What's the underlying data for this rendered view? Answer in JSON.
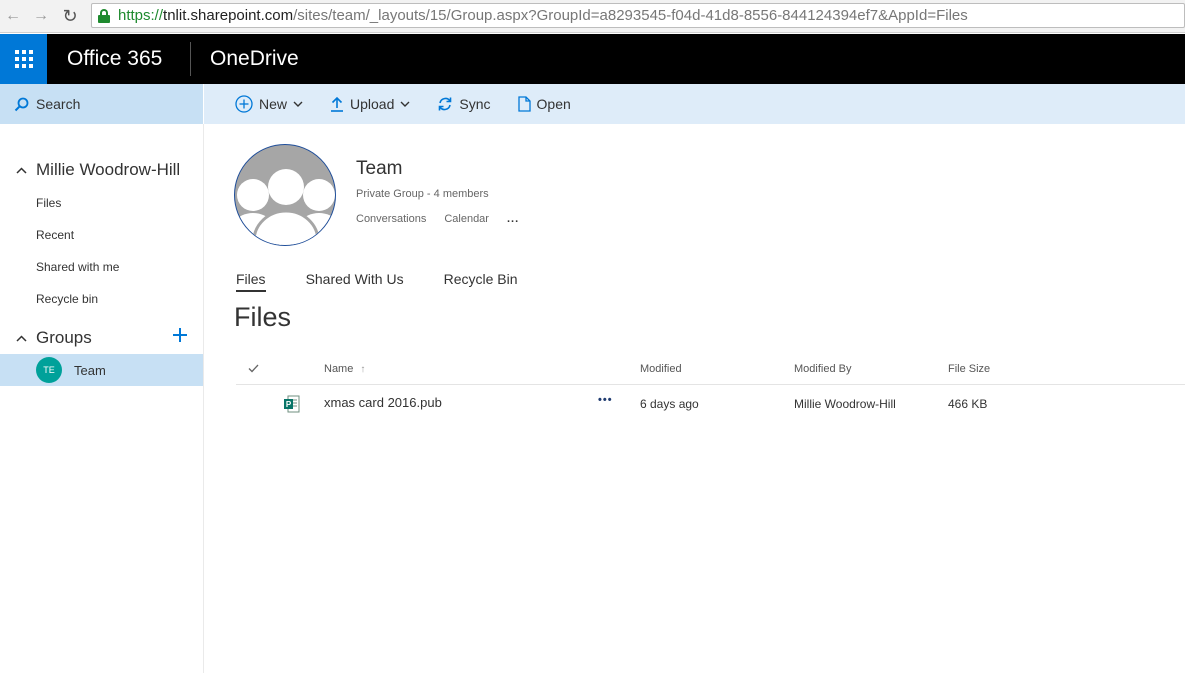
{
  "browser": {
    "url_scheme": "https://",
    "url_host": "tnlit.sharepoint.com",
    "url_path": "/sites/team/_layouts/15/Group.aspx?GroupId=a8293545-f04d-41d8-8556-844124394ef7&AppId=Files"
  },
  "suite": {
    "brand": "Office 365",
    "app": "OneDrive"
  },
  "search": {
    "label": "Search"
  },
  "commands": {
    "new": "New",
    "upload": "Upload",
    "sync": "Sync",
    "open": "Open"
  },
  "nav": {
    "user": "Millie Woodrow-Hill",
    "items": [
      "Files",
      "Recent",
      "Shared with me",
      "Recycle bin"
    ],
    "groups_label": "Groups",
    "group": {
      "initials": "TE",
      "name": "Team"
    }
  },
  "group": {
    "title": "Team",
    "subtitle": "Private Group - 4 members",
    "links": [
      "Conversations",
      "Calendar"
    ],
    "more": "..."
  },
  "pivots": [
    "Files",
    "Shared With Us",
    "Recycle Bin"
  ],
  "files_heading": "Files",
  "table": {
    "columns": {
      "name": "Name",
      "sort_indicator": "↑",
      "modified": "Modified",
      "modified_by": "Modified By",
      "size": "File Size"
    },
    "rows": [
      {
        "name": "xmas card 2016.pub",
        "more": "•••",
        "modified": "6 days ago",
        "modified_by": "Millie Woodrow-Hill",
        "size": "466 KB"
      }
    ]
  },
  "colors": {
    "accent": "#0078d7",
    "suite_bg": "#000000",
    "cmdbar_bg": "#deecf9",
    "selected_bg": "#c7e0f4",
    "avatar": "#00a19a"
  }
}
